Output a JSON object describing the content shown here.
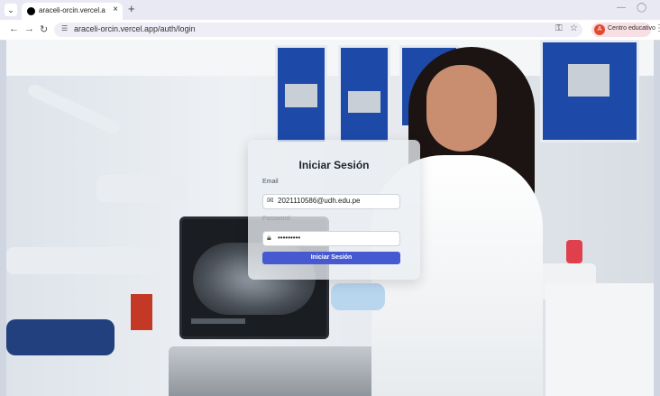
{
  "browser": {
    "tab_title": "araceli-orcin.vercel.app/auth/lo",
    "close_glyph": "×",
    "new_tab_glyph": "+",
    "url": "araceli-orcin.vercel.app/auth/login",
    "profile_initial": "A",
    "profile_name": "Centro educativo"
  },
  "login": {
    "title": "Iniciar Sesión",
    "email_label": "Email",
    "email_value": "2021110586@udh.edu.pe",
    "password_label": "Password",
    "password_value": "•••••••••",
    "submit_label": "Iniciar Sesión"
  },
  "icons": {
    "tab_menu": "chevron-down-icon",
    "favicon": "site-favicon-icon",
    "back": "arrow-left-icon",
    "forward": "arrow-right-icon",
    "reload": "reload-icon",
    "site_info": "tune-icon",
    "password_key": "key-icon",
    "bookmark": "star-icon",
    "email": "envelope-icon",
    "password": "lock-icon"
  }
}
